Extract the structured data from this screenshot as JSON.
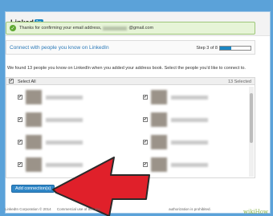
{
  "brand": {
    "logo_text": "Linked",
    "logo_in": "in"
  },
  "confirm": {
    "text_before": "Thanks for confirming your email address,",
    "text_after": "@gmail.com"
  },
  "connect": {
    "title": "Connect with people you know on LinkedIn",
    "step": "Step 3 of 8",
    "progress": 0.375
  },
  "intro": "We found 13 people you know on LinkedIn when you added your address book. Select the people you'd like to connect to.",
  "list": {
    "select_all": "Select All",
    "selected_count": "13 Selected",
    "checkbox_mark": "✔"
  },
  "action": {
    "add_button": "Add connection(s)"
  },
  "footer": {
    "copyright": "LinkedIn Corporation © 2014",
    "terms_a": "Commercial use of this site",
    "terms_b": "authorization is prohibited."
  },
  "watermark": "wikiHow",
  "colors": {
    "accent": "#1b86c3",
    "arrow": "#e0202a",
    "background": "#5ba2d9"
  }
}
